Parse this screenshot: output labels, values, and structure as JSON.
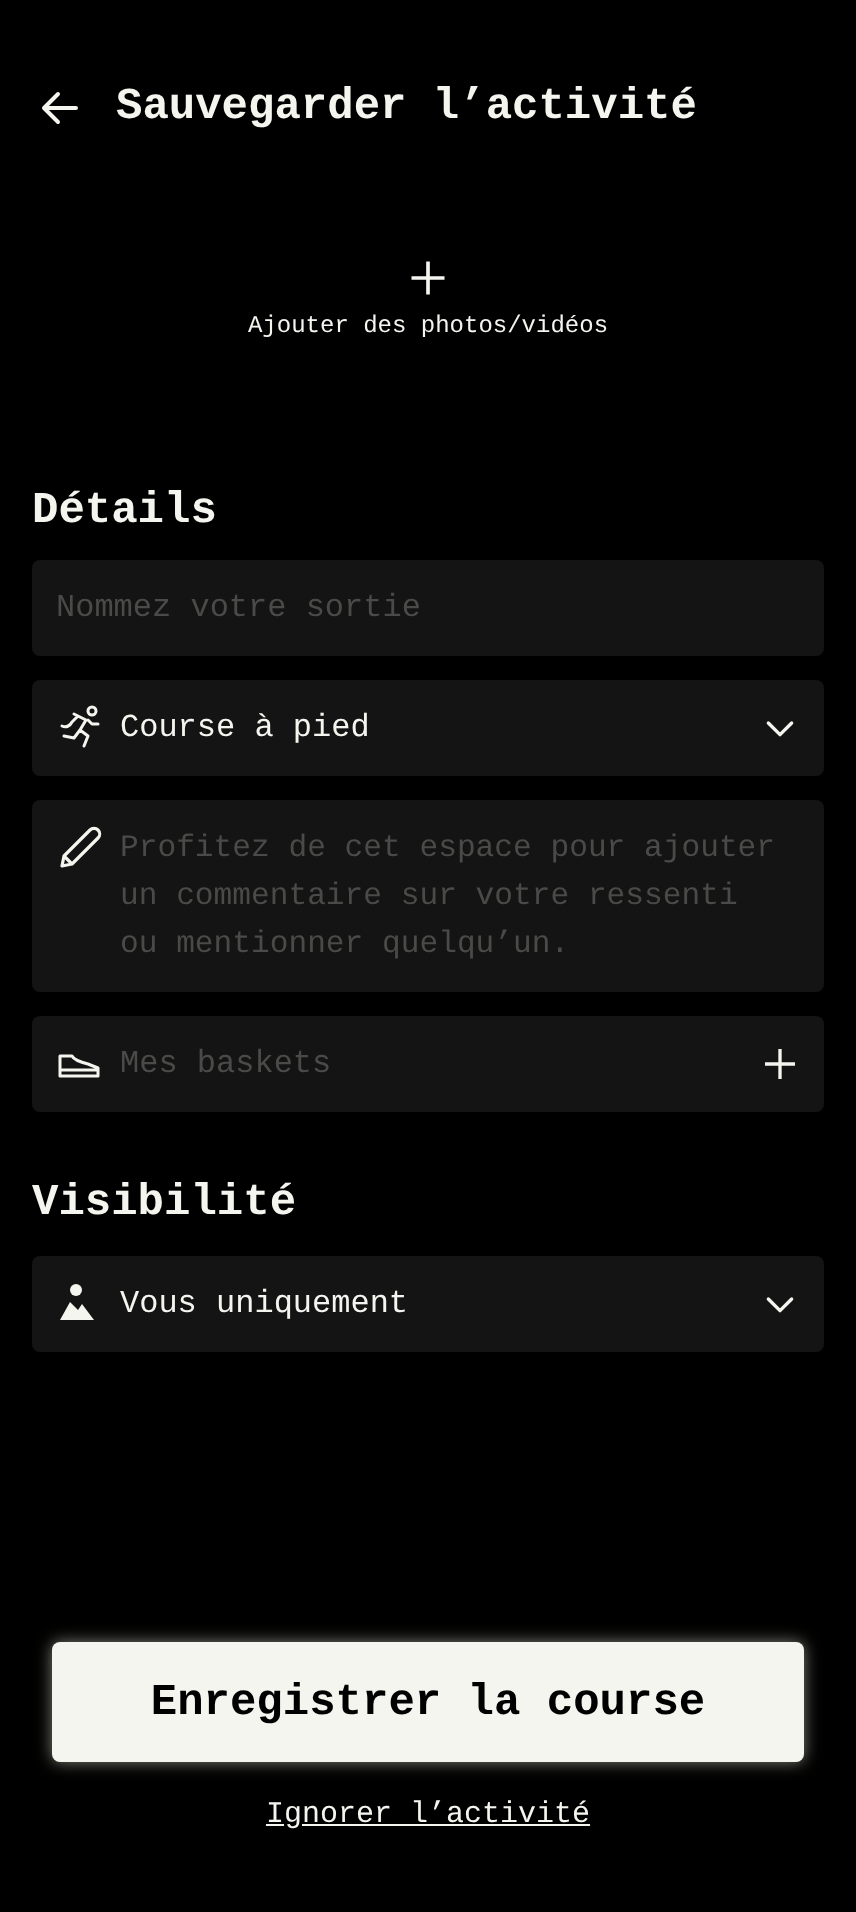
{
  "header": {
    "title": "Sauvegarder l’activité"
  },
  "media": {
    "label": "Ajouter des photos/vidéos"
  },
  "details": {
    "title": "Détails",
    "fields": [
      {
        "kind": "text",
        "placeholder": "Nommez votre sortie"
      },
      {
        "kind": "sport",
        "value": "Course à pied"
      },
      {
        "kind": "comment",
        "placeholder": "Profitez de cet espace pour ajouter un commentaire sur votre ressenti ou mentionner quelqu’un."
      },
      {
        "kind": "gear",
        "placeholder": "Mes baskets"
      }
    ]
  },
  "visibility": {
    "title": "Visibilité",
    "fields": [
      {
        "kind": "audience",
        "value": "Vous uniquement"
      }
    ]
  },
  "actions": {
    "primary": "Enregistrer la course",
    "secondary": "Ignorer l’activité"
  }
}
